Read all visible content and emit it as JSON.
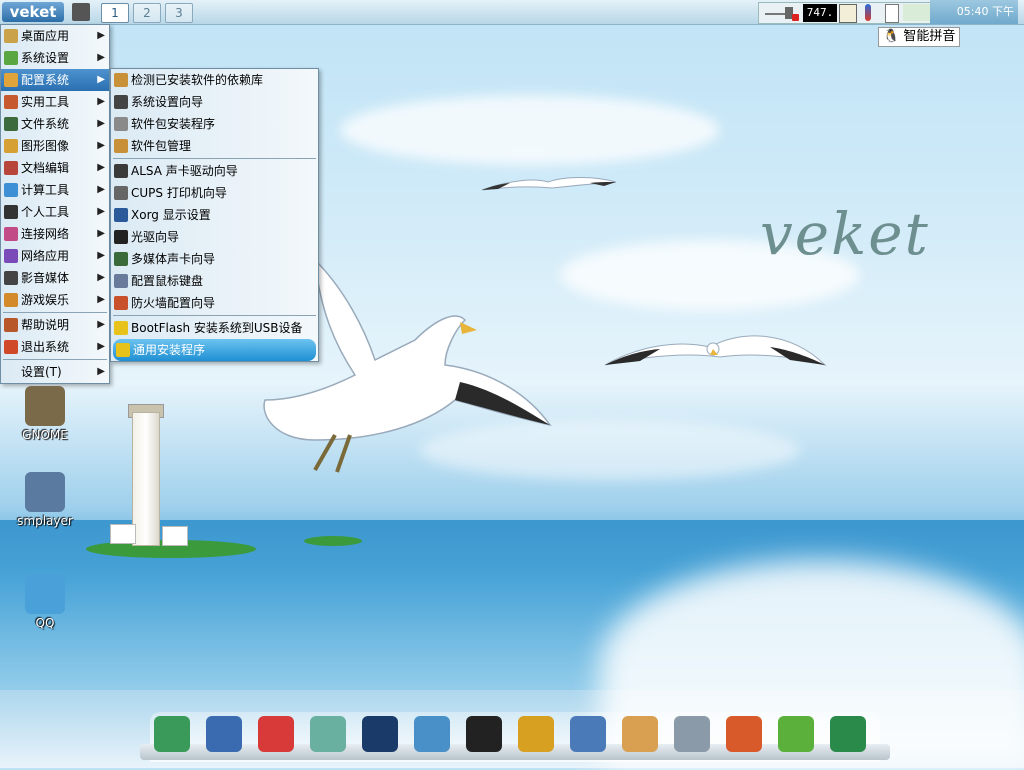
{
  "top_panel": {
    "menu_label": "veket",
    "workspaces": [
      "1",
      "2",
      "3"
    ],
    "cpu_readout": "747.",
    "clock": "05:40 下午"
  },
  "ime": {
    "label": "智能拼音"
  },
  "main_menu": {
    "items": [
      {
        "label": "桌面应用",
        "icon": "desktop-app-icon",
        "color": "#c9a24a"
      },
      {
        "label": "系统设置",
        "icon": "system-settings-icon",
        "color": "#5aa640"
      },
      {
        "label": "配置系统",
        "icon": "config-system-icon",
        "color": "#e0a43a"
      },
      {
        "label": "实用工具",
        "icon": "utilities-icon",
        "color": "#c65a2e"
      },
      {
        "label": "文件系统",
        "icon": "filesystem-icon",
        "color": "#3e6b3e"
      },
      {
        "label": "图形图像",
        "icon": "graphics-icon",
        "color": "#d6a035"
      },
      {
        "label": "文档编辑",
        "icon": "document-edit-icon",
        "color": "#b8463a"
      },
      {
        "label": "计算工具",
        "icon": "calculator-icon",
        "color": "#3d8fd6"
      },
      {
        "label": "个人工具",
        "icon": "personal-tools-icon",
        "color": "#333333"
      },
      {
        "label": "连接网络",
        "icon": "network-connect-icon",
        "color": "#c24a86"
      },
      {
        "label": "网络应用",
        "icon": "network-app-icon",
        "color": "#7a4ab8"
      },
      {
        "label": "影音媒体",
        "icon": "media-icon",
        "color": "#444444"
      },
      {
        "label": "游戏娱乐",
        "icon": "games-icon",
        "color": "#d38a2a"
      },
      {
        "label": "帮助说明",
        "icon": "help-icon",
        "color": "#b8572a"
      },
      {
        "label": "退出系统",
        "icon": "exit-icon",
        "color": "#d04a2a"
      },
      {
        "label": "设置(T)",
        "icon": "",
        "color": ""
      }
    ]
  },
  "submenu": {
    "items": [
      {
        "label": "检测已安装软件的依赖库",
        "icon": "dependency-check-icon",
        "color": "#c9903a"
      },
      {
        "label": "系统设置向导",
        "icon": "settings-wizard-icon",
        "color": "#444444"
      },
      {
        "label": "软件包安装程序",
        "icon": "package-installer-icon",
        "color": "#8a8a8a"
      },
      {
        "label": "软件包管理",
        "icon": "package-manager-icon",
        "color": "#c9903a"
      },
      {
        "label": "ALSA 声卡驱动向导",
        "icon": "sound-driver-icon",
        "color": "#3a3a3a"
      },
      {
        "label": "CUPS 打印机向导",
        "icon": "printer-icon",
        "color": "#666666"
      },
      {
        "label": "Xorg 显示设置",
        "icon": "display-icon",
        "color": "#2a5a9a"
      },
      {
        "label": "光驱向导",
        "icon": "cdrom-icon",
        "color": "#222222"
      },
      {
        "label": "多媒体声卡向导",
        "icon": "multimedia-sound-icon",
        "color": "#3a6a3a"
      },
      {
        "label": "配置鼠标键盘",
        "icon": "keyboard-mouse-icon",
        "color": "#6a7a9a"
      },
      {
        "label": "防火墙配置向导",
        "icon": "firewall-icon",
        "color": "#c8502a"
      },
      {
        "label": "BootFlash 安装系统到USB设备",
        "icon": "lightning-icon",
        "color": "#e6c21a"
      },
      {
        "label": "通用安装程序",
        "icon": "lightning-icon",
        "color": "#e6c21a"
      }
    ]
  },
  "desktop_icons": [
    {
      "label": "GNOME",
      "icon": "gnome-icon",
      "color": "#7a6a4a"
    },
    {
      "label": "smplayer",
      "icon": "smplayer-icon",
      "color": "#5a7aa0"
    },
    {
      "label": "QQ",
      "icon": "qq-icon",
      "color": "#4aa0d8"
    }
  ],
  "wallpaper": {
    "logo": "veket"
  },
  "dock": [
    {
      "icon": "folder-icon",
      "color": "#3a9a5a"
    },
    {
      "icon": "monitor-icon",
      "color": "#3a6ab0"
    },
    {
      "icon": "pet-icon",
      "color": "#d83a3a"
    },
    {
      "icon": "text-editor-icon",
      "color": "#6ab0a0"
    },
    {
      "icon": "media-player-icon",
      "color": "#1a3a6a"
    },
    {
      "icon": "messenger-icon",
      "color": "#4a90c8"
    },
    {
      "icon": "penguin-icon",
      "color": "#222222"
    },
    {
      "icon": "notebook-icon",
      "color": "#d8a020"
    },
    {
      "icon": "presentation-icon",
      "color": "#4a7ab8"
    },
    {
      "icon": "paint-palette-icon",
      "color": "#d8a050"
    },
    {
      "icon": "usb-drive-icon",
      "color": "#8a9aa8"
    },
    {
      "icon": "calendar-icon",
      "color": "#d85a2a"
    },
    {
      "icon": "help-question-icon",
      "color": "#5ab03a"
    },
    {
      "icon": "camera-icon",
      "color": "#2a8a4a"
    }
  ]
}
